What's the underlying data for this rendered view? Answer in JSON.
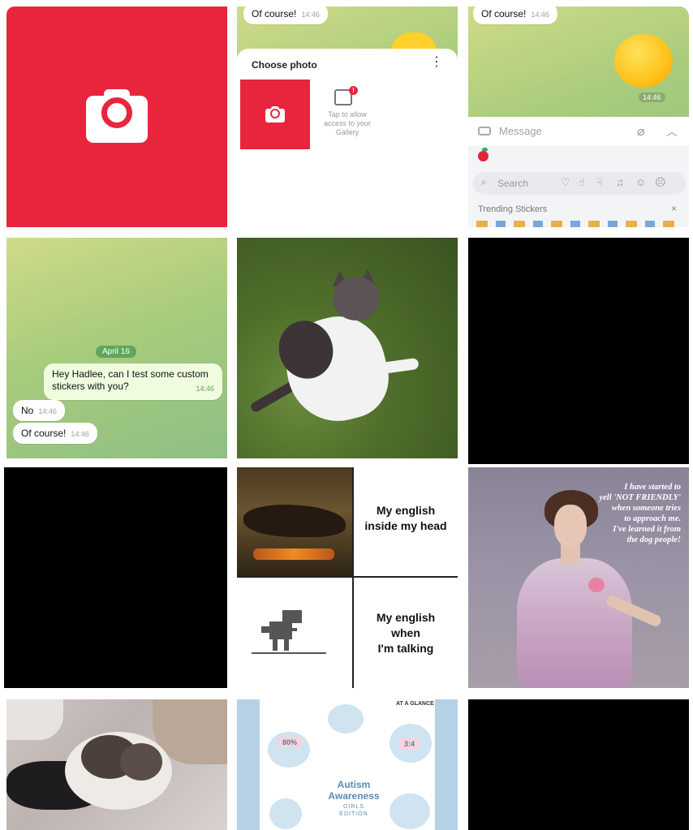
{
  "tiles": {
    "camera": {
      "icon": "camera-icon"
    },
    "choose_photo": {
      "top_bubble": {
        "text": "Of course!",
        "time": "14:46"
      },
      "sheet_title": "Choose photo",
      "menu_icon": "more-vertical-icon",
      "gallery_badge": "!",
      "gallery_text": "Tap to allow access to your Gallery"
    },
    "sticker_chat": {
      "top_bubble": {
        "text": "Of course!",
        "time": "14:46"
      },
      "emoji_time": "14:46",
      "message_placeholder": "Message",
      "search_placeholder": "Search",
      "trending_label": "Trending Stickers",
      "close": "×"
    },
    "chat": {
      "date": "April 16",
      "outgoing": {
        "text": "Hey Hadlee, can I test some custom stickers with you?",
        "line1": "Hey Hadlee, can I test some custom",
        "line2": "stickers with you?",
        "time": "14:46"
      },
      "incoming": [
        {
          "text": "No",
          "time": "14:46"
        },
        {
          "text": "Of course!",
          "time": "14:46"
        }
      ]
    },
    "meme": {
      "top_right": [
        "My english",
        "inside my head"
      ],
      "bottom_right": [
        "My english",
        "when",
        "I'm talking"
      ]
    },
    "painting": {
      "quote": [
        "I have started to",
        "yell 'NOT FRIENDLY'",
        "when someone tries",
        "to approach me.",
        "I've learned it from",
        "the dog people!"
      ]
    },
    "poster": {
      "at_a_glance": "AT A GLANCE",
      "stat1": "80%",
      "stat2": "3:4",
      "title": [
        "Autism",
        "Awareness"
      ],
      "subtitle": [
        "GIRLS",
        "EDITION"
      ]
    }
  },
  "colors": {
    "camera_red": "#e8253c",
    "telegram_green": "#5fa65a",
    "bubble_out": "#effdde"
  }
}
